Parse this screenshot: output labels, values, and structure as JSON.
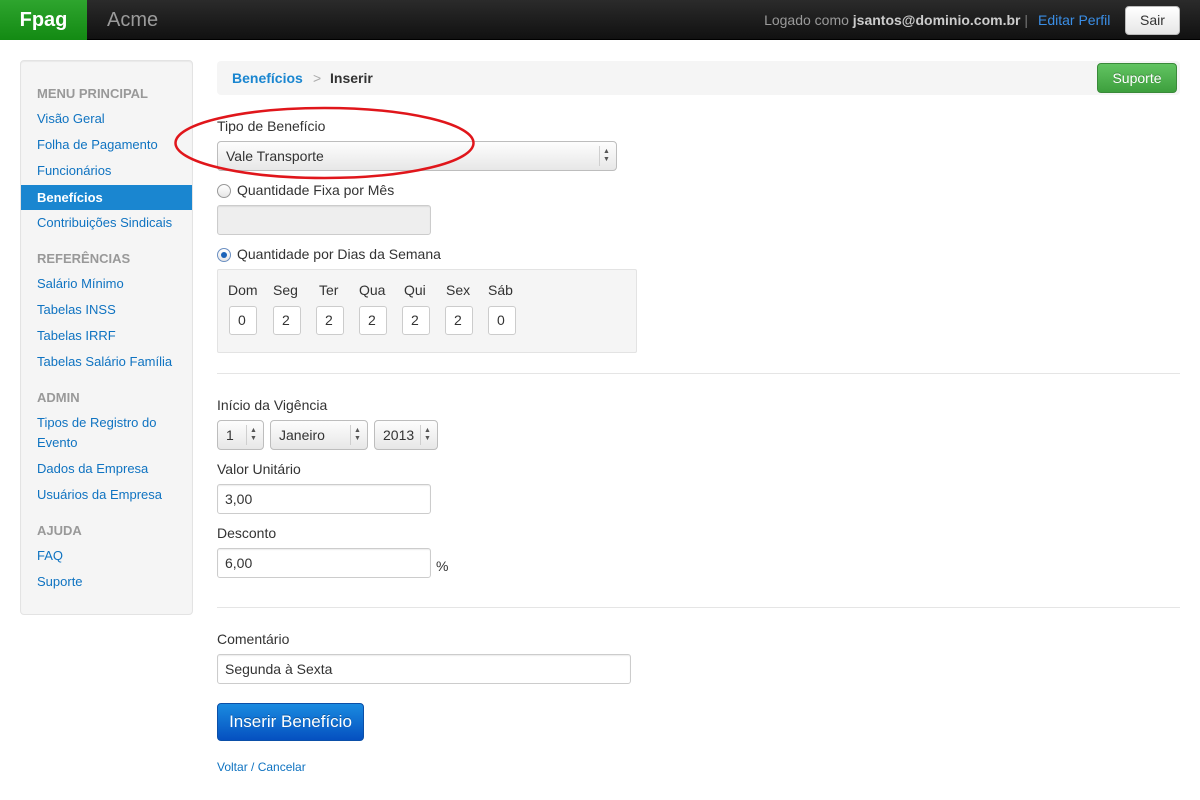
{
  "topbar": {
    "brand": "Fpag",
    "company": "Acme",
    "logged_as_prefix": "Logado como ",
    "user": "jsantos@dominio.com.br",
    "separator": " |",
    "edit_profile": "Editar Perfil",
    "logout": "Sair"
  },
  "sidebar": {
    "main_header": "MENU PRINCIPAL",
    "main_items": [
      "Visão Geral",
      "Folha de Pagamento",
      "Funcionários",
      "Benefícios",
      "Contribuições Sindicais"
    ],
    "active_item": "Benefícios",
    "ref_header": "REFERÊNCIAS",
    "ref_items": [
      "Salário Mínimo",
      "Tabelas INSS",
      "Tabelas IRRF",
      "Tabelas Salário Família"
    ],
    "admin_header": "ADMIN",
    "admin_items": [
      "Tipos de Registro do Evento",
      "Dados da Empresa",
      "Usuários da Empresa"
    ],
    "help_header": "AJUDA",
    "help_items": [
      "FAQ",
      "Suporte"
    ]
  },
  "breadcrumb": {
    "parent": "Benefícios",
    "sep": ">",
    "current": "Inserir",
    "support_button": "Suporte"
  },
  "form": {
    "benefit_type_label": "Tipo de Benefício",
    "benefit_type_value": "Vale Transporte",
    "fixed_qty_label": "Quantidade Fixa por Mês",
    "fixed_qty_value": "",
    "days_qty_label": "Quantidade por Dias da Semana",
    "days": [
      {
        "label": "Dom",
        "value": "0"
      },
      {
        "label": "Seg",
        "value": "2"
      },
      {
        "label": "Ter",
        "value": "2"
      },
      {
        "label": "Qua",
        "value": "2"
      },
      {
        "label": "Qui",
        "value": "2"
      },
      {
        "label": "Sex",
        "value": "2"
      },
      {
        "label": "Sáb",
        "value": "0"
      }
    ],
    "start_label": "Início da Vigência",
    "start_day": "1",
    "start_month": "Janeiro",
    "start_year": "2013",
    "unit_value_label": "Valor Unitário",
    "unit_value": "3,00",
    "discount_label": "Desconto",
    "discount_value": "6,00",
    "percent_sign": "%",
    "comment_label": "Comentário",
    "comment_value": "Segunda à Sexta",
    "submit": "Inserir Benefício",
    "cancel": "Voltar / Cancelar"
  },
  "colors": {
    "brand_green": "#1e9a1e",
    "link_blue": "#0f73c1",
    "active_blue": "#1a86d0",
    "annotation_red": "#e0161b"
  }
}
